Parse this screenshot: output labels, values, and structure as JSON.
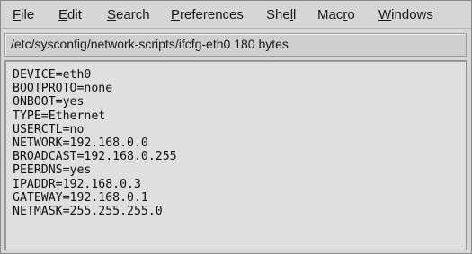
{
  "menubar": {
    "items": [
      {
        "pre": "",
        "u": "F",
        "post": "ile"
      },
      {
        "pre": "",
        "u": "E",
        "post": "dit"
      },
      {
        "pre": "",
        "u": "S",
        "post": "earch"
      },
      {
        "pre": "",
        "u": "P",
        "post": "references"
      },
      {
        "pre": "She",
        "u": "l",
        "post": "l"
      },
      {
        "pre": "Mac",
        "u": "r",
        "post": "o"
      },
      {
        "pre": "",
        "u": "W",
        "post": "indows"
      }
    ]
  },
  "status": {
    "path": "/etc/sysconfig/network-scripts/ifcfg-eth0 180 bytes"
  },
  "editor": {
    "lines": [
      "DEVICE=eth0",
      "BOOTPROTO=none",
      "ONBOOT=yes",
      "TYPE=Ethernet",
      "USERCTL=no",
      "NETWORK=192.168.0.0",
      "BROADCAST=192.168.0.255",
      "PEERDNS=yes",
      "IPADDR=192.168.0.3",
      "GATEWAY=192.168.0.1",
      "NETMASK=255.255.255.0"
    ]
  }
}
